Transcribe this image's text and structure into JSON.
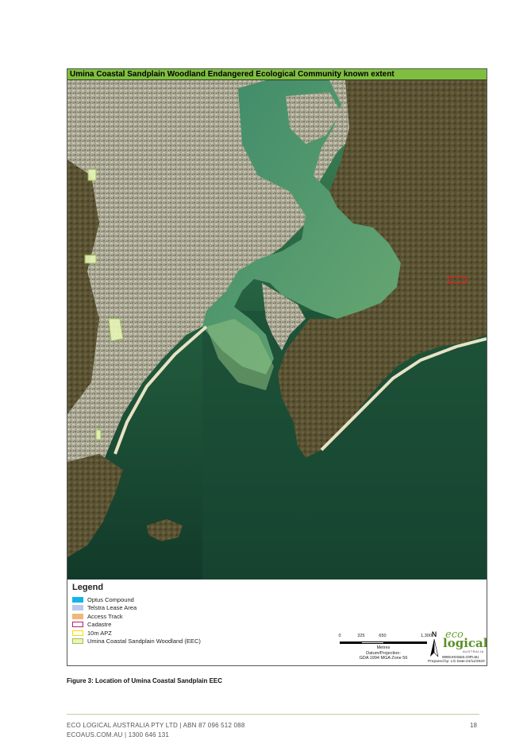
{
  "map": {
    "title": "Umina Coastal Sandplain Woodland Endangered Ecological Community known extent"
  },
  "legend": {
    "title": "Legend",
    "items": [
      {
        "label": "Optus Compound",
        "fill": "#13b4e8",
        "border": "#13b4e8"
      },
      {
        "label": "Telstra Lease Area",
        "fill": "#b9c9ee",
        "border": "#b9c9ee"
      },
      {
        "label": "Access Track",
        "fill": "#f0b878",
        "border": "#f0b878"
      },
      {
        "label": "Cadastre",
        "fill": "#ffffff",
        "border": "#c01a70"
      },
      {
        "label": "10m APZ",
        "fill": "#ffffff",
        "border": "#f2e000"
      },
      {
        "label": "Umina Coastal Sandplain Woodland (EEC)",
        "fill": "#e9f5b8",
        "border": "#9ac35a"
      }
    ]
  },
  "scalebar": {
    "ticks": [
      "0",
      "325",
      "650",
      "1,300"
    ],
    "unit": "Metres",
    "projection_line1": "Datum/Projection:",
    "projection_line2": "GDA 1994 MGA Zone 56"
  },
  "north_arrow": {
    "label": "N"
  },
  "logo": {
    "eco": "eco",
    "logical": "logical",
    "australia": "AUSTRALIA",
    "website": "www.ecoaus.com.au"
  },
  "prepared": "Prepared by: LG    Date:24/11/2020",
  "caption": "Figure 3: Location of Umina Coastal Sandplain EEC",
  "footer": {
    "line1": "ECO LOGICAL AUSTRALIA PTY LTD | ABN 87 096 512 088",
    "line2": "ECOAUS.COM.AU | 1300 646 131",
    "page_number": "18"
  },
  "colors": {
    "title_bar": "#7fbf3f",
    "ocean": "#1f5a3a",
    "estuary": "#4f9a6a",
    "land_urban": "#9a9a86",
    "bushland": "#57502e",
    "beach": "#e9e2c4"
  }
}
